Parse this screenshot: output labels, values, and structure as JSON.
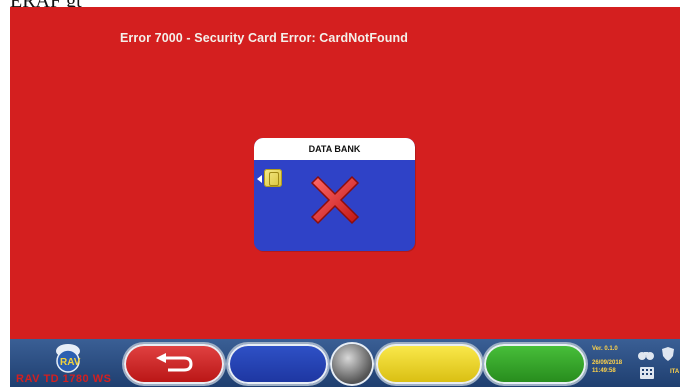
{
  "top_text": "ERAF gt",
  "error": {
    "title": "Error 7000 - Security Card Error: CardNotFound"
  },
  "card": {
    "header": "DATA BANK"
  },
  "logo": {
    "model": "RAV TD 1780 WS"
  },
  "status": {
    "version": "Ver. 0.1.0",
    "date": "26/09/2018",
    "time": "11:49:58",
    "language": "ITA"
  },
  "colors": {
    "screen_bg": "#d41f1f",
    "card_bg": "#2f42c7",
    "bar_bg": "#1f3f70"
  }
}
